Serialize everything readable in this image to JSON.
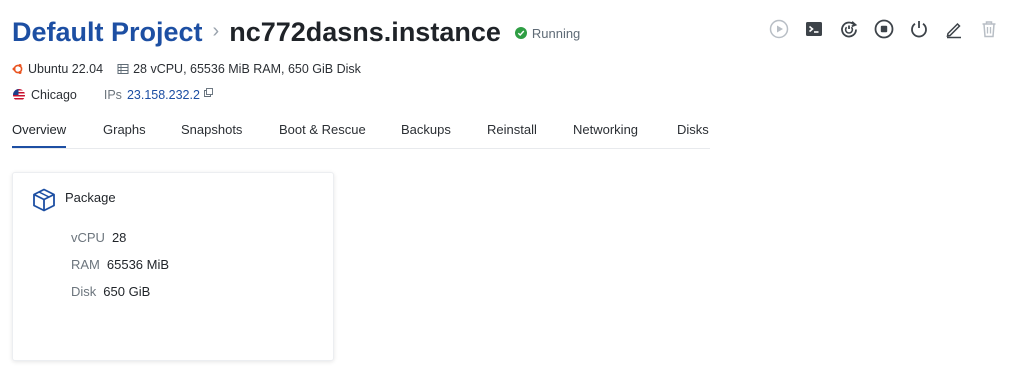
{
  "header": {
    "project": "Default Project",
    "separator": "›",
    "instance": "nc772dasns.instance",
    "status": "Running",
    "status_color": "#2f9e44",
    "accent": "#1d4fa3"
  },
  "actions": [
    {
      "icon": "play-icon"
    },
    {
      "icon": "console-icon"
    },
    {
      "icon": "reboot-icon"
    },
    {
      "icon": "stop-icon"
    },
    {
      "icon": "power-icon"
    },
    {
      "icon": "edit-icon"
    },
    {
      "icon": "trash-icon"
    }
  ],
  "meta": {
    "os": "Ubuntu 22.04",
    "specs": "28 vCPU, 65536 MiB RAM, 650 GiB Disk",
    "location": "Chicago",
    "ips_label": "IPs",
    "ip": "23.158.232.2"
  },
  "tabs": [
    "Overview",
    "Graphs",
    "Snapshots",
    "Boot & Rescue",
    "Backups",
    "Reinstall",
    "Networking",
    "Disks"
  ],
  "active_tab": "Overview",
  "package": {
    "title": "Package",
    "rows": [
      {
        "key": "vCPU",
        "value": "28"
      },
      {
        "key": "RAM",
        "value": "65536 MiB"
      },
      {
        "key": "Disk",
        "value": "650 GiB"
      }
    ]
  }
}
